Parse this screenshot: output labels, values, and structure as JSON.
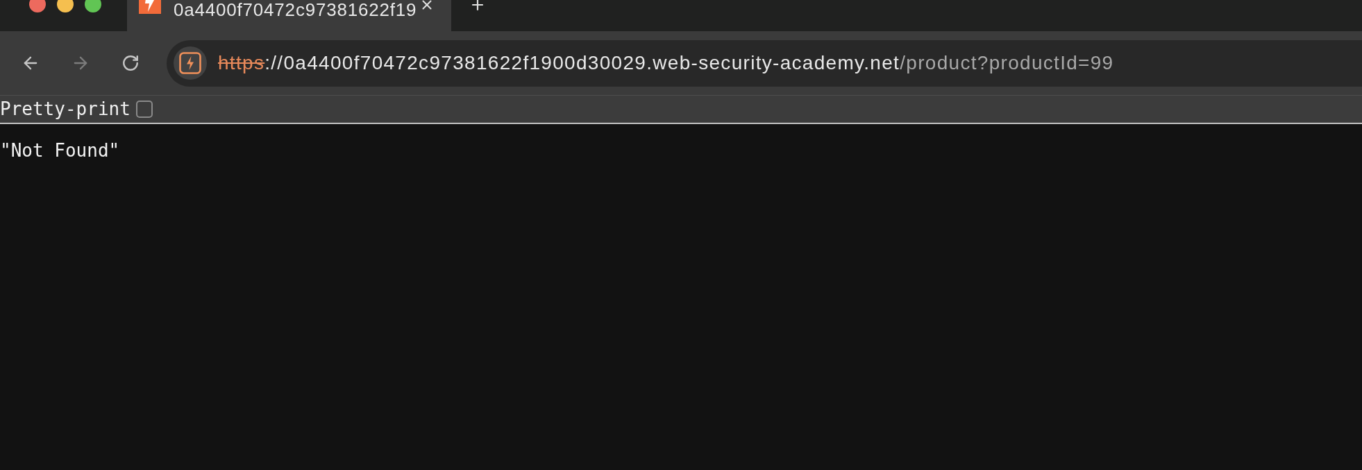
{
  "window_controls": [
    {
      "color": "#ed6a5e"
    },
    {
      "color": "#f5bf4f"
    },
    {
      "color": "#61c554"
    }
  ],
  "tabs": [
    {
      "title": "0a4400f70472c97381622f19",
      "selected": true
    }
  ],
  "nav_buttons": [
    {
      "kind": "back",
      "disabled": false
    },
    {
      "kind": "forward",
      "disabled": true
    },
    {
      "kind": "reload",
      "disabled": false
    }
  ],
  "address_bar": {
    "secure": false,
    "scheme": "https",
    "host": "://0a4400f70472c97381622f1900d30029.web-security-academy.net",
    "path": "/product?productId=99"
  },
  "pretty_print": {
    "label": "Pretty-print",
    "checked": false
  },
  "body": {
    "text": "\"Not Found\""
  }
}
